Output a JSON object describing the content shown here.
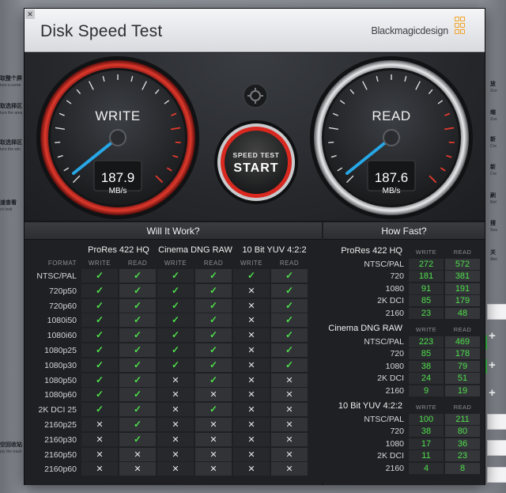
{
  "window": {
    "title": "Disk Speed Test",
    "brand": "Blackmagicdesign",
    "close_glyph": "✕"
  },
  "colors": {
    "accent_red": "#e23a2e",
    "needle_blue": "#27a7e6",
    "check_green": "#4fe04a",
    "brand_orange": "#f2a323"
  },
  "gauges": {
    "write": {
      "label": "WRITE",
      "value": "187.9",
      "unit": "MB/s"
    },
    "read": {
      "label": "READ",
      "value": "187.6",
      "unit": "MB/s"
    },
    "start_button": {
      "top_label": "SPEED TEST",
      "main_label": "START"
    },
    "settings_icon": "gear-icon"
  },
  "will_it_work": {
    "title": "Will It Work?",
    "format_label": "FORMAT",
    "write_label": "WRITE",
    "read_label": "READ",
    "groups": [
      "ProRes 422 HQ",
      "Cinema DNG RAW",
      "10 Bit YUV 4:2:2"
    ],
    "rows": [
      {
        "format": "NTSC/PAL",
        "marks": [
          "✓",
          "✓",
          "✓",
          "✓",
          "✓",
          "✓"
        ]
      },
      {
        "format": "720p50",
        "marks": [
          "✓",
          "✓",
          "✓",
          "✓",
          "✕",
          "✓"
        ]
      },
      {
        "format": "720p60",
        "marks": [
          "✓",
          "✓",
          "✓",
          "✓",
          "✕",
          "✓"
        ]
      },
      {
        "format": "1080i50",
        "marks": [
          "✓",
          "✓",
          "✓",
          "✓",
          "✕",
          "✓"
        ]
      },
      {
        "format": "1080i60",
        "marks": [
          "✓",
          "✓",
          "✓",
          "✓",
          "✕",
          "✓"
        ]
      },
      {
        "format": "1080p25",
        "marks": [
          "✓",
          "✓",
          "✓",
          "✓",
          "✕",
          "✓"
        ]
      },
      {
        "format": "1080p30",
        "marks": [
          "✓",
          "✓",
          "✓",
          "✓",
          "✕",
          "✓"
        ]
      },
      {
        "format": "1080p50",
        "marks": [
          "✓",
          "✓",
          "✕",
          "✓",
          "✕",
          "✕"
        ]
      },
      {
        "format": "1080p60",
        "marks": [
          "✓",
          "✓",
          "✕",
          "✕",
          "✕",
          "✕"
        ]
      },
      {
        "format": "2K DCI 25",
        "marks": [
          "✓",
          "✓",
          "✕",
          "✓",
          "✕",
          "✕"
        ]
      },
      {
        "format": "2160p25",
        "marks": [
          "✕",
          "✓",
          "✕",
          "✕",
          "✕",
          "✕"
        ]
      },
      {
        "format": "2160p30",
        "marks": [
          "✕",
          "✓",
          "✕",
          "✕",
          "✕",
          "✕"
        ]
      },
      {
        "format": "2160p50",
        "marks": [
          "✕",
          "✕",
          "✕",
          "✕",
          "✕",
          "✕"
        ]
      },
      {
        "format": "2160p60",
        "marks": [
          "✕",
          "✕",
          "✕",
          "✕",
          "✕",
          "✕"
        ]
      }
    ]
  },
  "how_fast": {
    "title": "How Fast?",
    "write_label": "WRITE",
    "read_label": "READ",
    "groups": [
      {
        "name": "ProRes 422 HQ",
        "rows": [
          {
            "format": "NTSC/PAL",
            "write": "272",
            "read": "572"
          },
          {
            "format": "720",
            "write": "181",
            "read": "381"
          },
          {
            "format": "1080",
            "write": "91",
            "read": "191"
          },
          {
            "format": "2K DCI",
            "write": "85",
            "read": "179"
          },
          {
            "format": "2160",
            "write": "23",
            "read": "48"
          }
        ]
      },
      {
        "name": "Cinema DNG RAW",
        "rows": [
          {
            "format": "NTSC/PAL",
            "write": "223",
            "read": "469"
          },
          {
            "format": "720",
            "write": "85",
            "read": "178"
          },
          {
            "format": "1080",
            "write": "38",
            "read": "79"
          },
          {
            "format": "2K DCI",
            "write": "24",
            "read": "51"
          },
          {
            "format": "2160",
            "write": "9",
            "read": "19"
          }
        ]
      },
      {
        "name": "10 Bit YUV 4:2:2",
        "rows": [
          {
            "format": "NTSC/PAL",
            "write": "100",
            "read": "211"
          },
          {
            "format": "720",
            "write": "38",
            "read": "80"
          },
          {
            "format": "1080",
            "write": "17",
            "read": "36"
          },
          {
            "format": "2K DCI",
            "write": "11",
            "read": "23"
          },
          {
            "format": "2160",
            "write": "4",
            "read": "8"
          }
        ]
      }
    ]
  },
  "desktop": {
    "left_items": [
      {
        "main": "取整个屏",
        "sub": "ture a scree"
      },
      {
        "main": "取选择区",
        "sub": "ture the area"
      },
      {
        "main": "取选择区",
        "sub": "ture the win"
      },
      {
        "main": "速查看",
        "sub": "ck look"
      },
      {
        "main": "空回收站",
        "sub": "pty the trash"
      }
    ],
    "right_items": [
      {
        "main": "放",
        "sub": "Zoo"
      },
      {
        "main": "缩",
        "sub": "Zoo"
      },
      {
        "main": "新",
        "sub": "Cre"
      },
      {
        "main": "新",
        "sub": "Cre"
      },
      {
        "main": "刷",
        "sub": "Ref"
      },
      {
        "main": "搜",
        "sub": "Sea"
      },
      {
        "main": "关",
        "sub": "Abo"
      }
    ],
    "plus_glyph": "+"
  }
}
